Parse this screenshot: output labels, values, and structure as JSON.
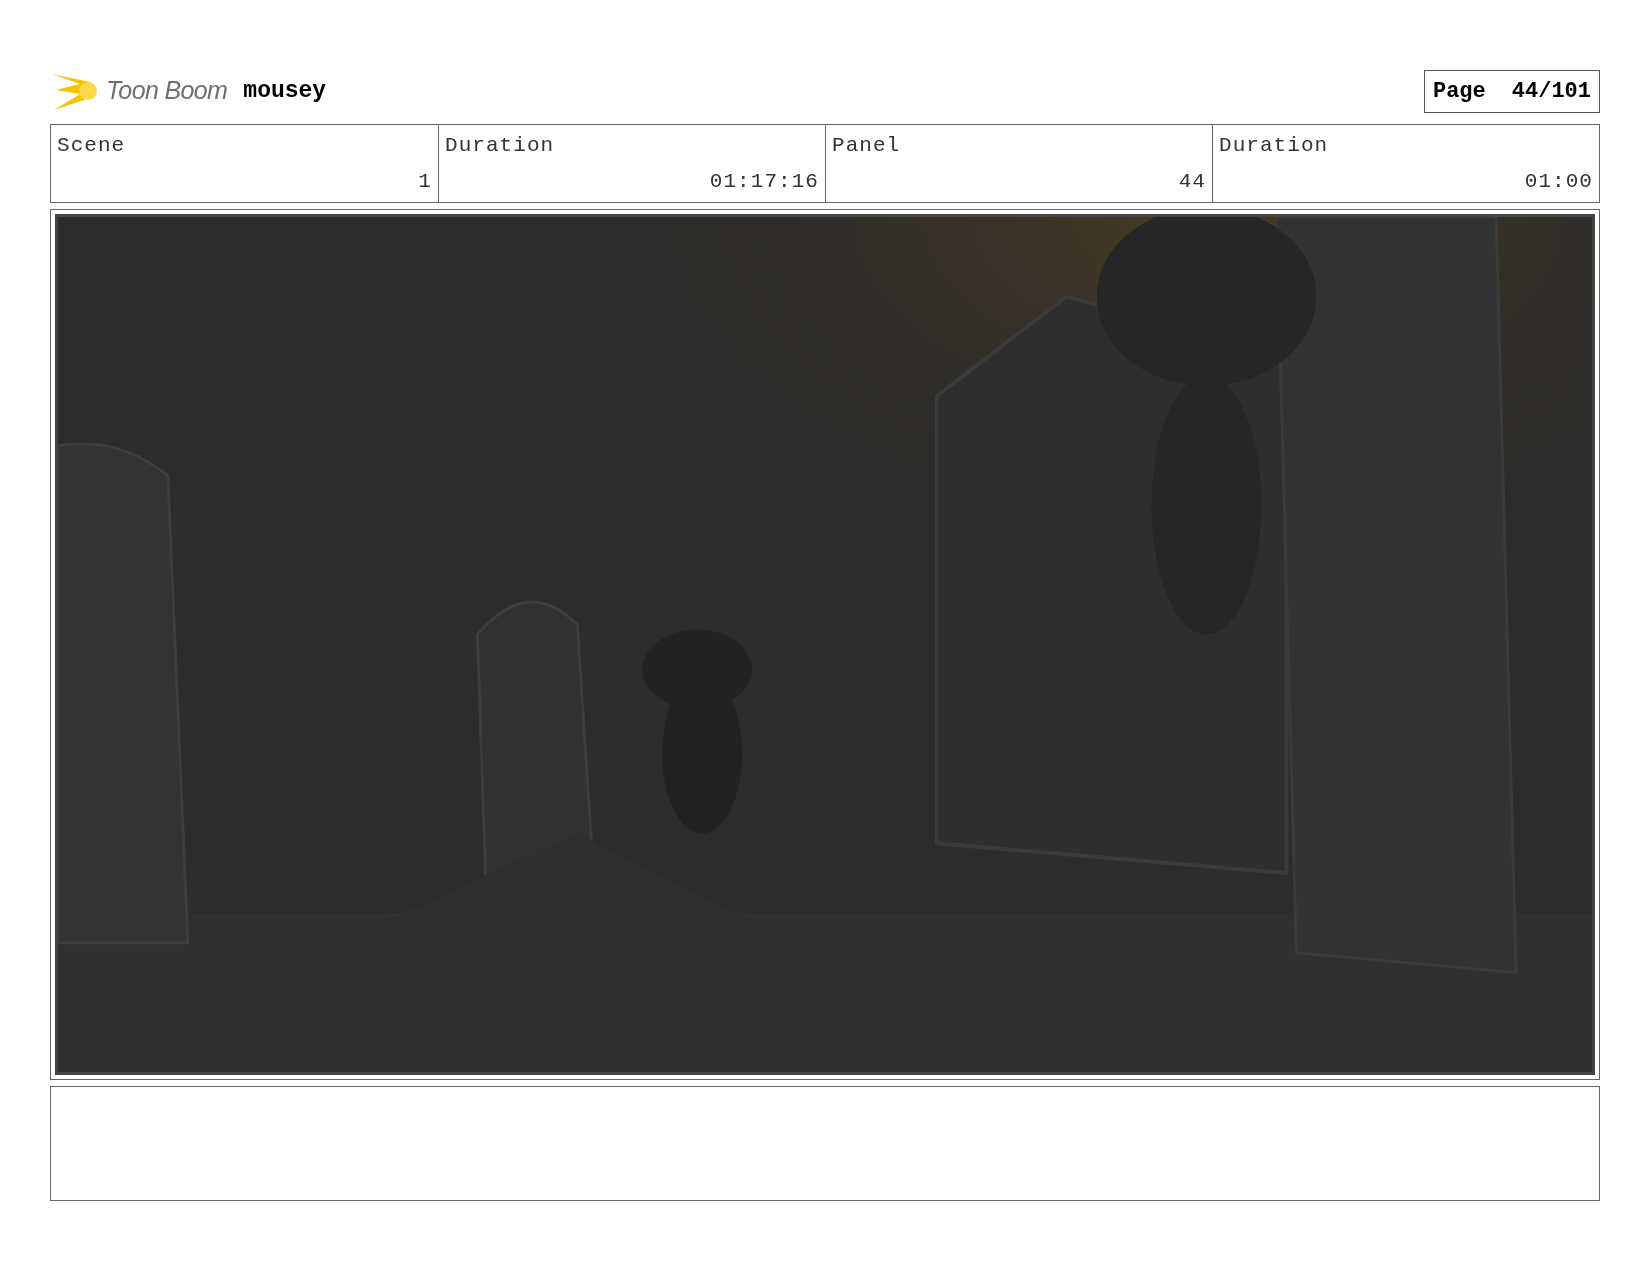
{
  "header": {
    "logo_text": "Toon Boom",
    "project": "mousey",
    "page_label": "Page",
    "page_number": "44/101"
  },
  "info_table": {
    "header_row": [
      "Scene",
      "Duration",
      "Panel",
      "Duration"
    ],
    "value_row": [
      "1",
      "01:17:16",
      "44",
      "01:00"
    ]
  }
}
